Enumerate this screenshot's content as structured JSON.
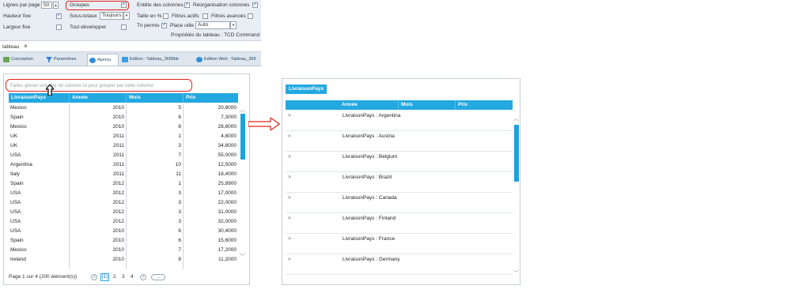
{
  "props": {
    "lignes_label": "Lignes par page",
    "lignes_value": "50",
    "hauteur_label": "Hauteur fixe",
    "largeur_label": "Largeur fixe",
    "groupes_label": "Groupes",
    "soustotaux_label": "Sous-totaux",
    "soustotaux_value": "Toujours",
    "toutdev_label": "Tout développer",
    "entete_label": "Entête des colonnes",
    "reorg_label": "Réorganisation colonnes",
    "taille_label": "Taille en %",
    "filtres_actifs_label": "Filtres actifs",
    "filtres_avances_label": "Filtres avancés",
    "tri_label": "Tri permis",
    "place_label": "Place utile",
    "place_value": "Auto",
    "footer": "Propriétés du tableau : TCD Command"
  },
  "window": {
    "title": "tableau",
    "close": "×"
  },
  "tabs": [
    {
      "label": "Conception"
    },
    {
      "label": "Paramètres"
    },
    {
      "label": "Aperçu"
    },
    {
      "label": "Edition : Tableau_3689bb"
    },
    {
      "label": "Edition Web : Tableau_368"
    }
  ],
  "left_grid": {
    "group_hint": "Faites glisser une tête de colonne ici pour grouper par cette colonne",
    "columns": [
      "LivraisonPays",
      "Année",
      "Mois",
      "Prix"
    ],
    "rows": [
      [
        "Mexico",
        "2010",
        "5",
        "20,8000"
      ],
      [
        "Spain",
        "2010",
        "6",
        "7,3000"
      ],
      [
        "Mexico",
        "2010",
        "8",
        "28,8000"
      ],
      [
        "UK",
        "2011",
        "1",
        "4,8000"
      ],
      [
        "UK",
        "2011",
        "3",
        "34,8000"
      ],
      [
        "USA",
        "2011",
        "7",
        "55,0000"
      ],
      [
        "Argentina",
        "2011",
        "10",
        "12,5000"
      ],
      [
        "Italy",
        "2011",
        "11",
        "18,4000"
      ],
      [
        "Spain",
        "2012",
        "1",
        "25,8900"
      ],
      [
        "USA",
        "2012",
        "3",
        "17,0000"
      ],
      [
        "USA",
        "2012",
        "3",
        "22,0000"
      ],
      [
        "USA",
        "2012",
        "3",
        "31,0000"
      ],
      [
        "USA",
        "2012",
        "3",
        "32,0000"
      ],
      [
        "USA",
        "2010",
        "6",
        "30,4000"
      ],
      [
        "Spain",
        "2010",
        "6",
        "15,6000"
      ],
      [
        "Mexico",
        "2010",
        "7",
        "17,2000"
      ],
      [
        "Ireland",
        "2010",
        "8",
        "11,2000"
      ]
    ],
    "pager_text": "Page 1 sur 4 (200 élément(s))",
    "pages": [
      "[1]",
      "2",
      "3",
      "4"
    ],
    "prev": "<",
    "next": ">",
    "more": "..."
  },
  "right_grid": {
    "group_tag": "LivraisonPays",
    "columns": [
      "Année",
      "Mois",
      "Prix"
    ],
    "expander": ">",
    "groups": [
      "LivraisonPays : Argentina",
      "LivraisonPays : Austria",
      "LivraisonPays : Belgium",
      "LivraisonPays : Brazil",
      "LivraisonPays : Canada",
      "LivraisonPays : Finland",
      "LivraisonPays : France",
      "LivraisonPays : Germany"
    ]
  },
  "colors": {
    "accent": "#23a8e0",
    "annotation": "#e0241b"
  }
}
